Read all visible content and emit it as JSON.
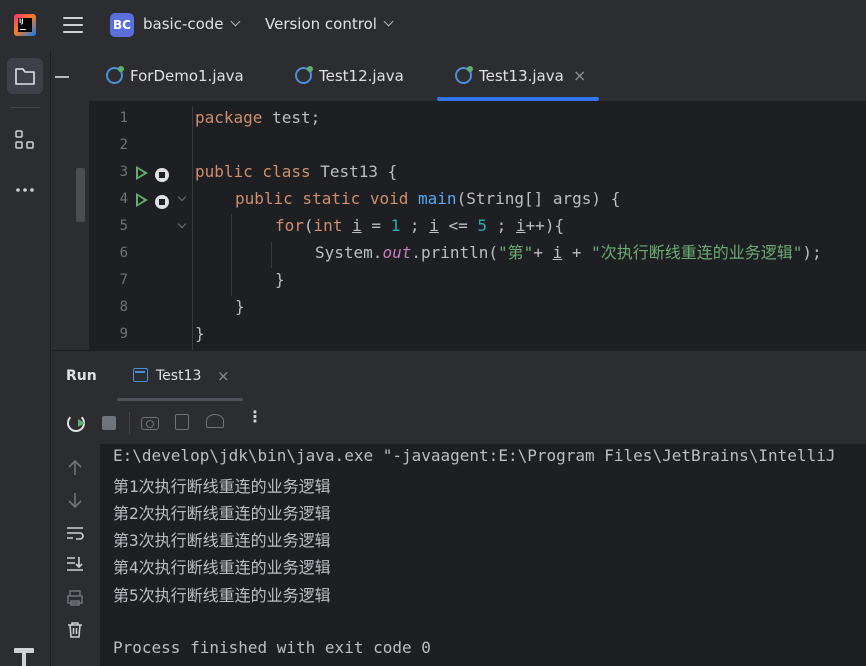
{
  "titlebar": {
    "logo_text": "IJ",
    "project_badge": "BC",
    "project_name": "basic-code",
    "vcs_label": "Version control"
  },
  "left_strip": {
    "icons": [
      "folder-icon",
      "structure-icon",
      "more-icon",
      "build-icon"
    ]
  },
  "editor_tabs": [
    {
      "label": "ForDemo1.java"
    },
    {
      "label": "Test12.java"
    },
    {
      "label": "Test13.java",
      "active": true,
      "close": "×"
    }
  ],
  "editor": {
    "line_numbers": [
      "1",
      "2",
      "3",
      "4",
      "5",
      "6",
      "7",
      "8",
      "9"
    ],
    "code": {
      "l1_kw": "package",
      "l1_rest": " test;",
      "l3_kw": "public class",
      "l3_rest": " Test13 {",
      "l4_kw": "public static void",
      "l4_fn": "main",
      "l4_rest": "(String[] args) {",
      "l5_kw": "for",
      "l5_a": "(",
      "l5_int": "int",
      "l5_i1": "i",
      "l5_b": " = ",
      "l5_n1": "1",
      "l5_c": " ; ",
      "l5_i2": "i",
      "l5_d": " <= ",
      "l5_n2": "5",
      "l5_e": " ; ",
      "l5_i3": "i",
      "l5_f": "++){",
      "l6_a": "System.",
      "l6_out": "out",
      "l6_b": ".println(",
      "l6_s1": "\"第\"",
      "l6_c": "+ ",
      "l6_i": "i",
      "l6_d": " + ",
      "l6_s2": "\"次执行断线重连的业务逻辑\"",
      "l6_e": ");",
      "l7": "}",
      "l8": "}",
      "l9": "}"
    }
  },
  "run_panel": {
    "title": "Run",
    "tab_label": "Test13",
    "tab_close": "×",
    "toolbar_more": "⋮",
    "console_lines": [
      "E:\\develop\\jdk\\bin\\java.exe \"-javaagent:E:\\Program Files\\JetBrains\\IntelliJ",
      "第1次执行断线重连的业务逻辑",
      "第2次执行断线重连的业务逻辑",
      "第3次执行断线重连的业务逻辑",
      "第4次执行断线重连的业务逻辑",
      "第5次执行断线重连的业务逻辑",
      "",
      "Process finished with exit code 0"
    ],
    "side_icons": [
      "up-arrow-icon",
      "down-arrow-icon",
      "soft-wrap-icon",
      "scroll-to-end-icon",
      "print-icon",
      "trash-icon"
    ]
  },
  "colors": {
    "accent": "#3574f0",
    "run_green": "#5fb06a",
    "keyword": "#cf8e6d",
    "string": "#6aab73",
    "number": "#2aacb8",
    "method": "#56a8f5"
  }
}
